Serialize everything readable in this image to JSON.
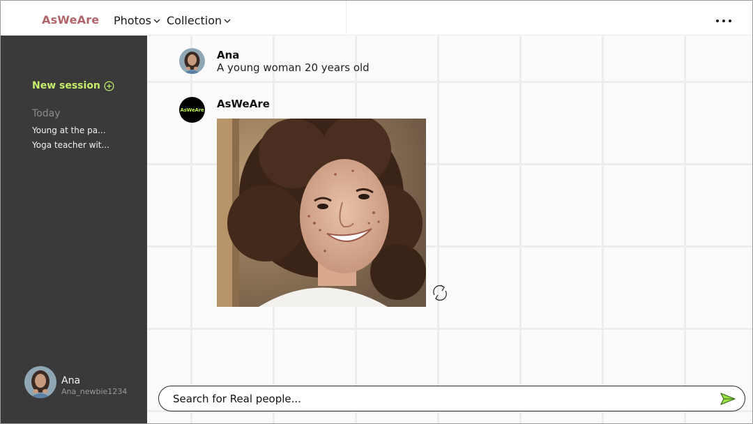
{
  "header": {
    "brand": "AsWeAre",
    "nav": [
      {
        "label": "Photos",
        "icon": "chevron-down-icon"
      },
      {
        "label": "Collection",
        "icon": "chevron-down-icon"
      }
    ],
    "more_icon": "more-icon"
  },
  "sidebar": {
    "new_session_label": "New session",
    "new_session_icon": "plus-circle-icon",
    "section_label": "Today",
    "history": [
      {
        "label": "Young at the pa..."
      },
      {
        "label": "Yoga teacher wit..."
      }
    ],
    "profile": {
      "name": "Ana",
      "handle": "Ana_newbie1234"
    }
  },
  "chat": {
    "messages": [
      {
        "author": "Ana",
        "text": "A young woman 20 years old"
      },
      {
        "author": "AsWeAre",
        "avatar_text": "AsWeAre",
        "content": "generated-photo"
      }
    ],
    "regenerate_icon": "refresh-icon"
  },
  "search": {
    "placeholder": "Search for Real people...",
    "send_icon": "send-icon"
  },
  "colors": {
    "brand": "#b0656a",
    "accent": "#c4f06a",
    "sidebar_bg": "#3a3a3a",
    "send": "#9be04a"
  }
}
